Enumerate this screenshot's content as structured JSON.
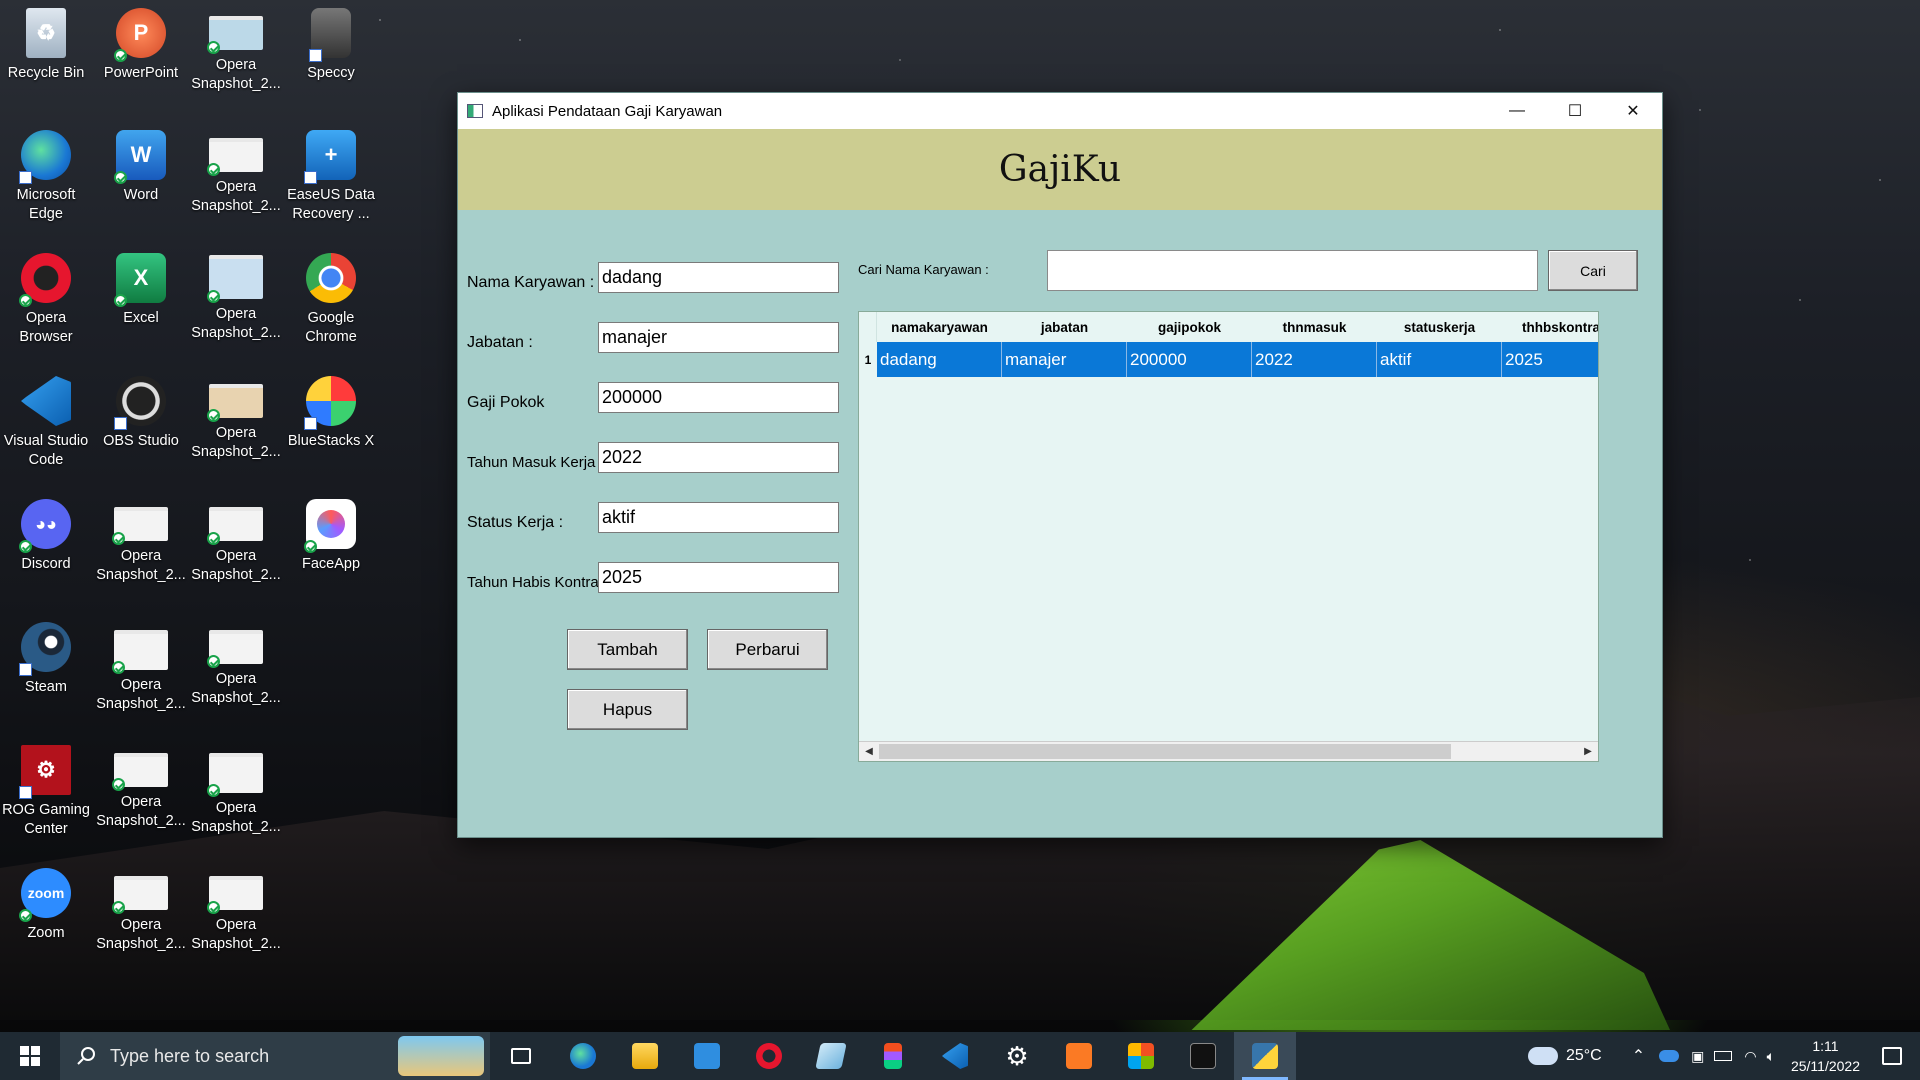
{
  "desktop": {
    "icons": [
      {
        "label": "Recycle Bin"
      },
      {
        "label": "PowerPoint"
      },
      {
        "label": "Opera\nSnapshot_2..."
      },
      {
        "label": "Speccy"
      },
      {
        "label": "Microsoft\nEdge"
      },
      {
        "label": "Word"
      },
      {
        "label": "Opera\nSnapshot_2..."
      },
      {
        "label": "EaseUS Data\nRecovery ..."
      },
      {
        "label": "Opera\nBrowser"
      },
      {
        "label": "Excel"
      },
      {
        "label": "Opera\nSnapshot_2..."
      },
      {
        "label": "Google\nChrome"
      },
      {
        "label": "Visual Studio\nCode"
      },
      {
        "label": "OBS Studio"
      },
      {
        "label": "Opera\nSnapshot_2..."
      },
      {
        "label": "BlueStacks X"
      },
      {
        "label": "Discord"
      },
      {
        "label": "Opera\nSnapshot_2..."
      },
      {
        "label": "Opera\nSnapshot_2..."
      },
      {
        "label": "FaceApp"
      },
      {
        "label": "Steam"
      },
      {
        "label": "Opera\nSnapshot_2..."
      },
      {
        "label": "Opera\nSnapshot_2..."
      },
      {
        "label": "ROG Gaming\nCenter"
      },
      {
        "label": "Opera\nSnapshot_2..."
      },
      {
        "label": "Opera\nSnapshot_2..."
      },
      {
        "label": "Zoom"
      },
      {
        "label": "Opera\nSnapshot_2..."
      },
      {
        "label": "Opera\nSnapshot_2..."
      }
    ]
  },
  "window": {
    "title": "Aplikasi Pendataan Gaji Karyawan",
    "minimize_glyph": "—",
    "maximize_glyph": "☐",
    "close_glyph": "✕",
    "brand": "GajiKu",
    "form": {
      "nama_label": "Nama Karyawan :",
      "nama_value": "dadang",
      "jabatan_label": "Jabatan :",
      "jabatan_value": "manajer",
      "gaji_label": "Gaji Pokok",
      "gaji_value": "200000",
      "tahun_masuk_label": "Tahun Masuk Kerja :",
      "tahun_masuk_value": "2022",
      "status_label": "Status Kerja :",
      "status_value": "aktif",
      "tahun_habis_label": "Tahun Habis Kontrak :",
      "tahun_habis_value": "2025"
    },
    "buttons": {
      "tambah": "Tambah",
      "perbarui": "Perbarui",
      "hapus": "Hapus",
      "cari": "Cari"
    },
    "search": {
      "label": "Cari Nama Karyawan :",
      "value": ""
    },
    "table": {
      "columns": [
        "namakaryawan",
        "jabatan",
        "gajipokok",
        "thnmasuk",
        "statuskerja",
        "thhbskontrak"
      ],
      "rows": [
        {
          "num": "1",
          "cells": [
            "dadang",
            "manajer",
            "200000",
            "2022",
            "aktif",
            "2025"
          ]
        }
      ]
    }
  },
  "taskbar": {
    "search_placeholder": "Type here to search",
    "weather": "25°C",
    "time": "1:11",
    "date": "25/11/2022"
  },
  "colors": {
    "window_bg": "#a7cfcb",
    "header_band": "#cccd91",
    "row_selected": "#0a78d7",
    "table_bg": "#e7f5f3"
  }
}
